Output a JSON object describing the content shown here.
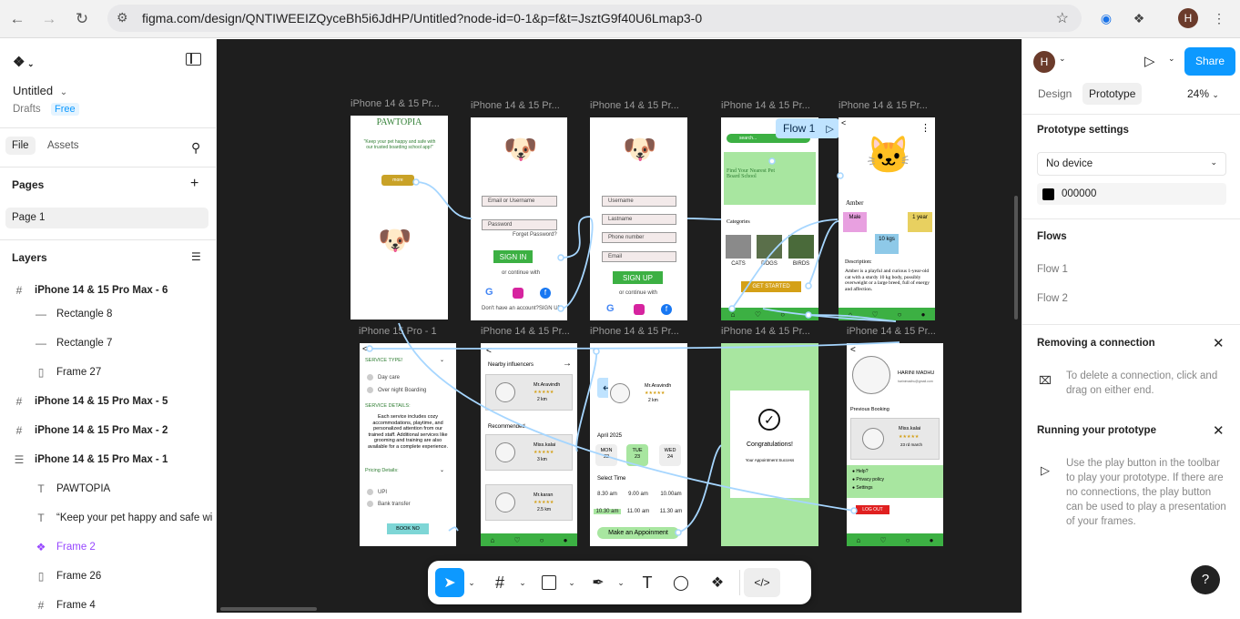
{
  "browser": {
    "url": "figma.com/design/QNTIWEEIZQyceBh5i6JdHP/Untitled?node-id=0-1&p=f&t=JsztG9f40U6Lmap3-0",
    "profile_initial": "H"
  },
  "file": {
    "name": "Untitled",
    "location": "Drafts",
    "plan": "Free",
    "tabs": [
      "File",
      "Assets"
    ]
  },
  "pages": {
    "heading": "Pages",
    "items": [
      "Page 1"
    ]
  },
  "layers": {
    "heading": "Layers",
    "items": [
      {
        "icon": "frame-icon",
        "label": "iPhone 14 & 15 Pro Max - 6",
        "bold": true,
        "indent": 0
      },
      {
        "icon": "rectangle-icon",
        "label": "Rectangle 8",
        "indent": 1
      },
      {
        "icon": "rectangle-icon",
        "label": "Rectangle 7",
        "indent": 1
      },
      {
        "icon": "autolayout-icon",
        "label": "Frame 27",
        "indent": 1
      },
      {
        "icon": "frame-icon",
        "label": "iPhone 14 & 15 Pro Max - 5",
        "bold": true,
        "indent": 0
      },
      {
        "icon": "frame-icon",
        "label": "iPhone 14 & 15 Pro Max - 2",
        "bold": true,
        "indent": 0
      },
      {
        "icon": "autolayout-vertical-icon",
        "label": "iPhone 14 & 15 Pro Max - 1",
        "bold": true,
        "indent": 0
      },
      {
        "icon": "text-icon",
        "label": "PAWTOPIA",
        "indent": 1
      },
      {
        "icon": "text-icon",
        "label": "“Keep your pet happy and safe wi",
        "indent": 1
      },
      {
        "icon": "component-icon",
        "label": "Frame 2",
        "indent": 1,
        "purple": true
      },
      {
        "icon": "autolayout-icon",
        "label": "Frame 26",
        "indent": 1
      },
      {
        "icon": "frame-icon",
        "label": "Frame 4",
        "indent": 1
      }
    ]
  },
  "canvas": {
    "frame_labels": [
      "iPhone 14 & 15 Pr...",
      "iPhone 14 & 15 Pr...",
      "iPhone 14 & 15 Pr...",
      "iPhone 14 & 15 Pr...",
      "iPhone 14 & 15 Pr...",
      "iPhone 15 Pro - 1",
      "iPhone 14 & 15 Pr...",
      "iPhone 14 & 15 Pr...",
      "iPhone 14 & 15 Pr...",
      "iPhone 14 & 15 Pr..."
    ],
    "flow_badge": "Flow 1",
    "screens": {
      "splash": {
        "title": "PAWTOPIA",
        "tagline": "\"Keep your pet happy and safe with our trusted boarding school app!\"",
        "button": "more"
      },
      "login": {
        "email": "Email or Username",
        "password": "Password",
        "forgot": "Forget Password?",
        "signin": "SIGN IN",
        "or": "or continue with",
        "signup_prompt": "Don't have an account?SIGN UP"
      },
      "signup": {
        "fields": [
          "Username",
          "Lastname",
          "Phone number",
          "Email"
        ],
        "signup": "SIGN UP",
        "or": "or continue with"
      },
      "home": {
        "search": "search...",
        "banner": "Find Your Nearest Pet Board School",
        "categories": "Categories",
        "cats": [
          "CATS",
          "DOGS",
          "BIRDS"
        ],
        "cta": "GET STARTED"
      },
      "pet": {
        "name": "Amber",
        "male": "Male",
        "age": "1 year",
        "weight": "10 kgs",
        "desc_heading": "Description:",
        "desc": "Amber is a playful and curious 1-year-old cat with a sturdy 10 kg body, possibly overweight or a large breed, full of energy and affection."
      },
      "service": {
        "type_heading": "SERVICE TYPE!",
        "options": [
          "Day care",
          "Over night Boarding"
        ],
        "details_heading": "SERVICE DETAILS:",
        "details": "Each service includes cozy accommodations, playtime, and personalized attention from our trained staff. Additional services like grooming and training are also available for a complete experience.",
        "pricing": "Pricing Details:",
        "pay": [
          "UPI",
          "Bank transfer"
        ],
        "book": "BOOK NO"
      },
      "influencers": {
        "heading": "Nearby influencers",
        "recommended": "Recommended",
        "people": [
          {
            "name": "Mr.Aravindh",
            "dist": "2 km"
          },
          {
            "name": "Miss.kalai",
            "dist": "3 km"
          },
          {
            "name": "Mr.karan",
            "dist": "2.5 km"
          }
        ]
      },
      "booking": {
        "name": "Mr.Aravindh",
        "dist": "2 km",
        "month": "April 2025",
        "days": [
          {
            "d": "MON",
            "n": "22"
          },
          {
            "d": "TUE",
            "n": "23"
          },
          {
            "d": "WED",
            "n": "24"
          }
        ],
        "select_time": "Select Time",
        "times": [
          "8.30 am",
          "9.00 am",
          "10.00am",
          "10.30 am",
          "11.00 am",
          "11.30 am"
        ],
        "cta": "Make an Appoinment"
      },
      "success": {
        "title": "Congratulations!",
        "sub": "Your Appointment Success"
      },
      "profile": {
        "name": "HARINI MADHU",
        "email": "harinimadhu@gmail.com",
        "prev": "Previous Booking",
        "booking_name": "Miss.kalai",
        "booking_date": "23 rd march",
        "menu": [
          "Help?",
          "Privacy policy",
          "Settings"
        ],
        "logout": "LOG OUT"
      }
    }
  },
  "right": {
    "user_initial": "H",
    "share": "Share",
    "tabs": [
      "Design",
      "Prototype"
    ],
    "active_tab": "Prototype",
    "zoom": "24%",
    "settings_heading": "Prototype settings",
    "device": "No device",
    "bg_color": "000000",
    "flows_heading": "Flows",
    "flows": [
      "Flow 1",
      "Flow 2"
    ],
    "removing_heading": "Removing a connection",
    "removing_text": "To delete a connection, click and drag on either end.",
    "running_heading": "Running your prototype",
    "running_text": "Use the play button in the toolbar to play your prototype. If there are no connections, the play button can be used to play a presentation of your frames."
  },
  "colors": {
    "accent": "#0d99ff",
    "canvas": "#1e1e1e",
    "app_green": "#3cb043",
    "light_green": "#a8e6a0",
    "purple": "#9747ff"
  }
}
